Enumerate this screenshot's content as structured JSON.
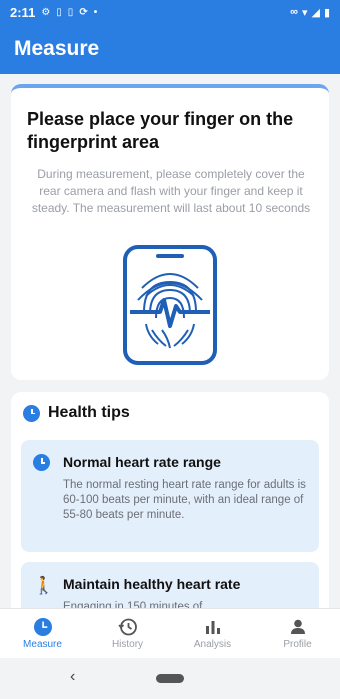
{
  "status_bar": {
    "time": "2:11",
    "left_icons": [
      "gear-icon",
      "sim-icon",
      "sim-icon",
      "sync-icon",
      "dot-icon"
    ],
    "right_icons": [
      "link-icon",
      "wifi-icon",
      "signal-icon",
      "battery-icon"
    ]
  },
  "app_bar": {
    "title": "Measure"
  },
  "instruction_card": {
    "heading": "Please place your finger on the fingerprint area",
    "description": "During measurement, please completely cover the rear camera and flash with your finger and keep it steady. The measurement will last about 10 seconds",
    "illustration": "phone-fingerprint-heartbeat-icon",
    "accent_color": "#2a7de1"
  },
  "health_tips": {
    "title": "Health tips",
    "tips": [
      {
        "icon": "clock-icon",
        "title": "Normal heart rate range",
        "text": "The normal resting heart rate range for adults is 60-100 beats per minute, with an ideal range of 55-80 beats per minute."
      },
      {
        "icon": "walk-icon",
        "title": "Maintain healthy heart rate",
        "text": "Engaging in 150 minutes of"
      }
    ]
  },
  "bottom_nav": {
    "items": [
      {
        "label": "Measure",
        "icon": "measure-icon",
        "active": true
      },
      {
        "label": "History",
        "icon": "history-icon",
        "active": false
      },
      {
        "label": "Analysis",
        "icon": "analysis-icon",
        "active": false
      },
      {
        "label": "Profile",
        "icon": "profile-icon",
        "active": false
      }
    ]
  },
  "colors": {
    "primary": "#2a7de1",
    "tip_background": "#e4effc",
    "page_background": "#f2f3f5"
  }
}
